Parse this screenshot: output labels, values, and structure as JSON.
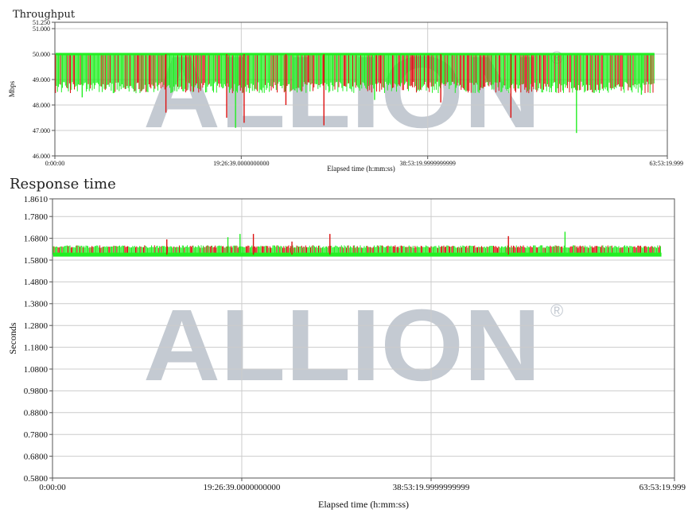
{
  "watermark": {
    "text": "ALLION",
    "mark": "®",
    "color": "#c4cad2"
  },
  "colors": {
    "series_a": "#dd1111",
    "series_b": "#22ee22",
    "grid": "#cccccc",
    "axis": "#555555"
  },
  "chart_data": [
    {
      "type": "line",
      "title": "Throughput",
      "xlabel": "Elapsed time (h:mm:ss)",
      "ylabel": "Mbps",
      "x_ticks": [
        "0:00:00",
        "19:26:39.0000000000",
        "38:53:19.9999999999",
        "63:53:19.999"
      ],
      "x_tick_pos": [
        0,
        0.3043,
        0.6087,
        1.0
      ],
      "y_ticks": [
        "46.000",
        "47.000",
        "48.000",
        "49.000",
        "50.000",
        "51.000",
        "51.250"
      ],
      "y_tick_vals": [
        46.0,
        47.0,
        48.0,
        49.0,
        50.0,
        51.0,
        51.25
      ],
      "ylim": [
        46.0,
        51.25
      ],
      "grid": true,
      "baseline": 50.0,
      "band_low": 48.6,
      "spikes": [
        {
          "x": 0.1813,
          "y": 47.7,
          "s": 0
        },
        {
          "x": 0.2805,
          "y": 47.5,
          "s": 0
        },
        {
          "x": 0.295,
          "y": 47.1,
          "s": 1
        },
        {
          "x": 0.309,
          "y": 47.3,
          "s": 0
        },
        {
          "x": 0.4393,
          "y": 47.2,
          "s": 0
        },
        {
          "x": 0.3772,
          "y": 48.0,
          "s": 0
        },
        {
          "x": 0.6301,
          "y": 48.1,
          "s": 0
        },
        {
          "x": 0.7446,
          "y": 47.5,
          "s": 0
        },
        {
          "x": 0.8517,
          "y": 46.9,
          "s": 1
        },
        {
          "x": 0.0446,
          "y": 48.3,
          "s": 1
        },
        {
          "x": 0.522,
          "y": 48.2,
          "s": 1
        },
        {
          "x": 0.9577,
          "y": 48.4,
          "s": 1
        }
      ]
    },
    {
      "type": "line",
      "title": "Response time",
      "xlabel": "Elapsed time (h:mm:ss)",
      "ylabel": "Seconds",
      "x_ticks": [
        "0:00:00",
        "19:26:39.0000000000",
        "38:53:19.9999999999",
        "63:53:19.999"
      ],
      "x_tick_pos": [
        0,
        0.3043,
        0.6087,
        1.0
      ],
      "y_ticks": [
        "0.5800",
        "0.6800",
        "0.7800",
        "0.8800",
        "0.9800",
        "1.0800",
        "1.1800",
        "1.2800",
        "1.3800",
        "1.4800",
        "1.5800",
        "1.6800",
        "1.7800",
        "1.8610"
      ],
      "y_tick_vals": [
        0.58,
        0.68,
        0.78,
        0.88,
        0.98,
        1.08,
        1.18,
        1.28,
        1.38,
        1.48,
        1.58,
        1.68,
        1.78,
        1.861
      ],
      "ylim": [
        0.58,
        1.861
      ],
      "grid": true,
      "baseline": 1.605,
      "band_high": 1.642,
      "spikes": [
        {
          "x": 0.1838,
          "y": 1.675,
          "s": 0
        },
        {
          "x": 0.282,
          "y": 1.685,
          "s": 1
        },
        {
          "x": 0.3015,
          "y": 1.7,
          "s": 1
        },
        {
          "x": 0.323,
          "y": 1.7,
          "s": 0
        },
        {
          "x": 0.385,
          "y": 1.665,
          "s": 0
        },
        {
          "x": 0.446,
          "y": 1.7,
          "s": 0
        },
        {
          "x": 0.733,
          "y": 1.69,
          "s": 0
        },
        {
          "x": 0.824,
          "y": 1.71,
          "s": 1
        }
      ]
    }
  ]
}
